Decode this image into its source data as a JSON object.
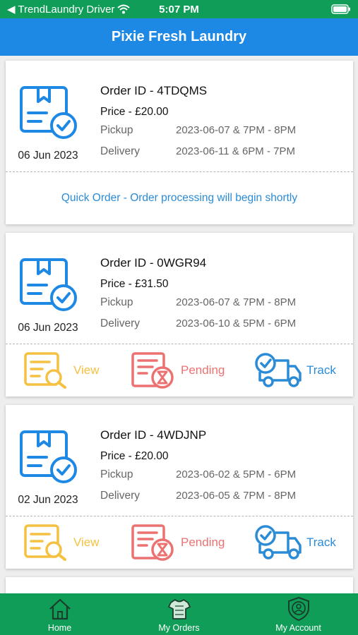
{
  "status_bar": {
    "back_label": "◀ TrendLaundry Driver",
    "time": "5:07 PM"
  },
  "header": {
    "title": "Pixie Fresh Laundry"
  },
  "labels": {
    "pickup": "Pickup",
    "delivery": "Delivery"
  },
  "orders": [
    {
      "id": "Order ID - 4TDQMS",
      "price": "Price - £20.00",
      "date": "06 Jun 2023",
      "pickup": "2023-06-07 & 7PM - 8PM",
      "delivery": "2023-06-11 & 6PM - 7PM",
      "note": "Quick Order - Order processing will begin shortly"
    },
    {
      "id": "Order ID - 0WGR94",
      "price": "Price - £31.50",
      "date": "06 Jun 2023",
      "pickup": "2023-06-07 & 7PM - 8PM",
      "delivery": "2023-06-10 & 5PM - 6PM"
    },
    {
      "id": "Order ID - 4WDJNP",
      "price": "Price - £20.00",
      "date": "02 Jun 2023",
      "pickup": "2023-06-02 & 5PM - 6PM",
      "delivery": "2023-06-05 & 7PM - 8PM"
    }
  ],
  "actions": {
    "view": "View",
    "pending": "Pending",
    "track": "Track"
  },
  "nav": [
    {
      "label": "Home",
      "icon": "home-icon"
    },
    {
      "label": "My Orders",
      "icon": "shirt-icon"
    },
    {
      "label": "My Account",
      "icon": "account-shield-icon"
    }
  ],
  "colors": {
    "green": "#0f9d58",
    "blue": "#1e88e5",
    "view": "#f5c142",
    "pending": "#ec7272",
    "track": "#2a8bd6"
  }
}
